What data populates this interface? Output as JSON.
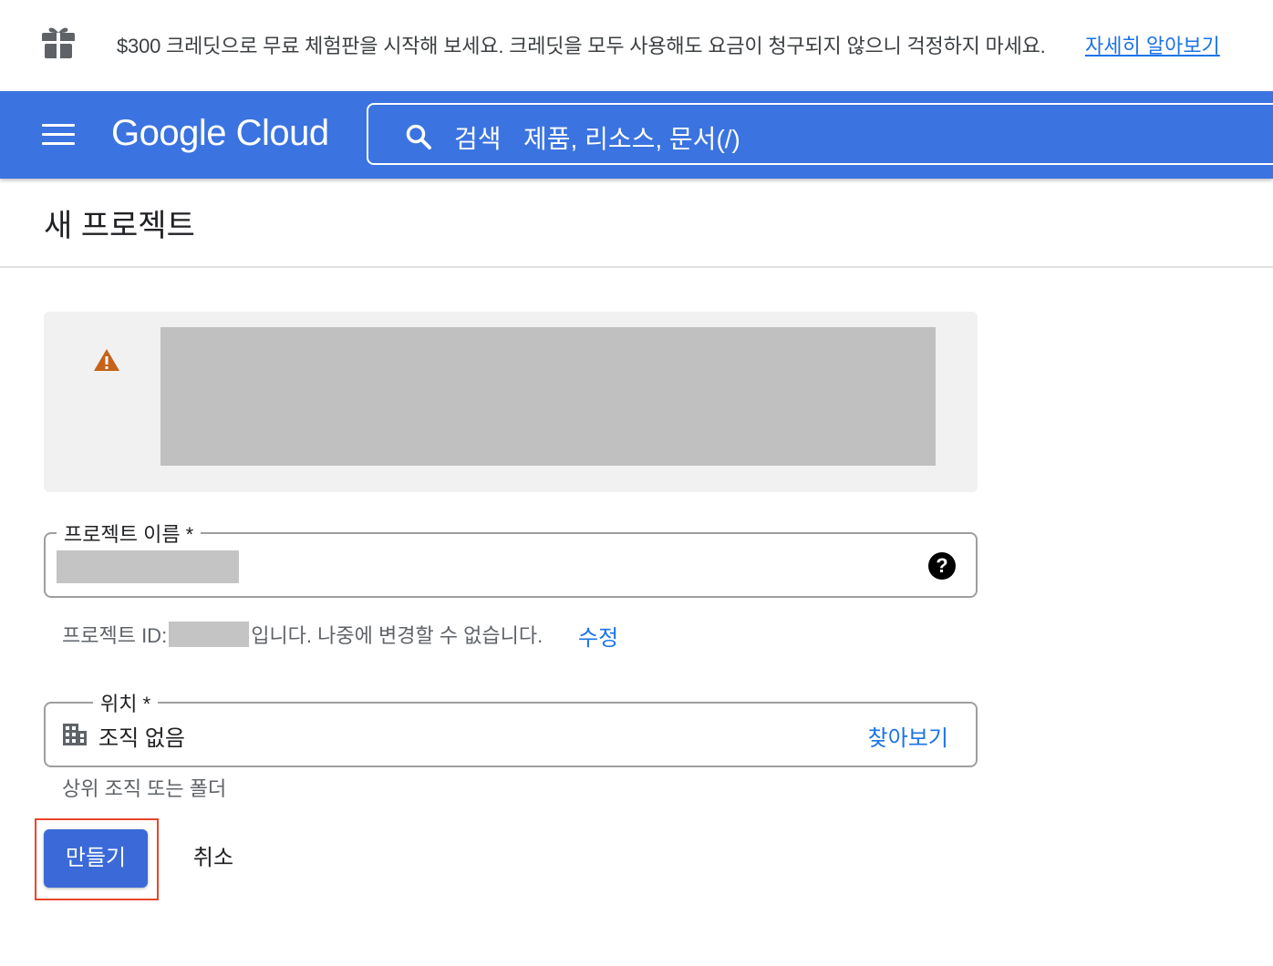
{
  "promo": {
    "text": "$300 크레딧으로 무료 체험판을 시작해 보세요. 크레딧을 모두 사용해도 요금이 청구되지 않으니 걱정하지 마세요.",
    "link": "자세히 알아보기"
  },
  "header": {
    "logo": "Google Cloud",
    "search_label": "검색",
    "search_placeholder": "제품, 리소스, 문서(/)"
  },
  "page": {
    "title": "새 프로젝트"
  },
  "form": {
    "name_label": "프로젝트 이름 *",
    "help_glyph": "?",
    "project_id_prefix": "프로젝트 ID:",
    "project_id_suffix": "입니다. 나중에 변경할 수 없습니다.",
    "edit_link": "수정",
    "location_label": "위치 *",
    "location_value": "조직 없음",
    "browse_link": "찾아보기",
    "location_help": "상위 조직 또는 폴더"
  },
  "actions": {
    "create": "만들기",
    "cancel": "취소"
  },
  "colors": {
    "appbar": "#3b73e0",
    "link": "#1a73e8",
    "primary_button": "#3b6ad8",
    "warning": "#c5631b",
    "highlight": "#e8472a"
  }
}
